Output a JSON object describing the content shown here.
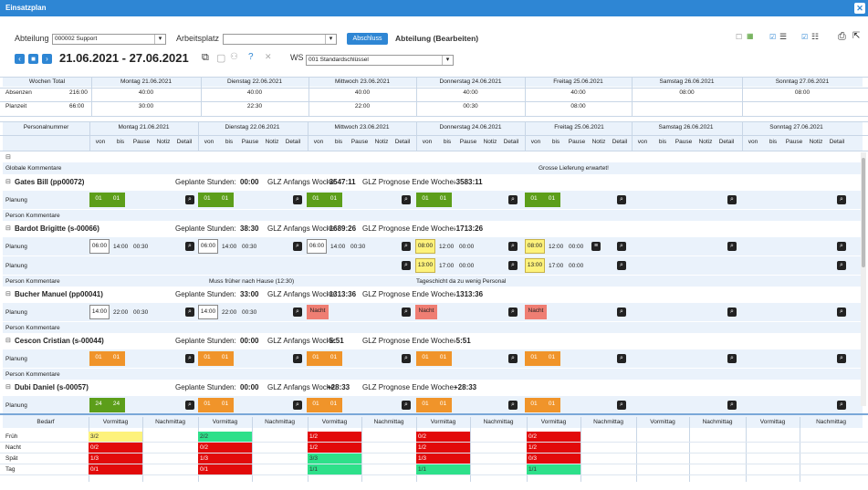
{
  "title": "Einsatzplan",
  "toolbar": {
    "abteilung_label": "Abteilung",
    "abteilung_value": "000002 Support",
    "arbeitsplatz_label": "Arbeitsplatz",
    "arbeitsplatz_value": "",
    "abschluss_label": "Abschluss",
    "abteilung_edit": "Abteilung (Bearbeiten)",
    "date_range": "21.06.2021 - 27.06.2021",
    "ws_label": "WS",
    "ws_value": "001 Standardschlüssel"
  },
  "summary": {
    "header": [
      "Wochen Total",
      "Montag 21.06.2021",
      "Dienstag 22.06.2021",
      "Mittwoch 23.06.2021",
      "Donnerstag 24.06.2021",
      "Freitag 25.06.2021",
      "Samstag 26.06.2021",
      "Sonntag 27.06.2021"
    ],
    "rows": [
      {
        "label": "Absenzen",
        "total": "216:00",
        "days": [
          "40:00",
          "40:00",
          "40:00",
          "40:00",
          "40:00",
          "08:00",
          "08:00"
        ]
      },
      {
        "label": "Planzeit",
        "total": "66:00",
        "days": [
          "30:00",
          "22:30",
          "22:00",
          "00:30",
          "08:00",
          "",
          ""
        ]
      }
    ]
  },
  "grid": {
    "personal_header": "Personalnummer",
    "days": [
      "Montag 21.06.2021",
      "Dienstag 22.06.2021",
      "Mittwoch 23.06.2021",
      "Donnerstag 24.06.2021",
      "Freitag 25.06.2021",
      "Samstag 26.06.2021",
      "Sonntag 27.06.2021"
    ],
    "sub": [
      "von",
      "bis",
      "Pause",
      "Notiz",
      "Detail"
    ],
    "global_comments": "Globale Kommentare",
    "global_note": "Grosse Lieferung erwartet!",
    "planung": "Planung",
    "person_comments": "Person Kommentare",
    "geplante": "Geplante Stunden:",
    "glz_anfang": "GLZ Anfangs Woche:",
    "glz_prognose": "GLZ Prognose Ende Woche:",
    "persons": [
      {
        "name": "Gates Bill (pp00072)",
        "hours": "00:00",
        "anfang": "-3547:11",
        "prognose": "-3583:11"
      },
      {
        "name": "Bardot Brigitte (s-00066)",
        "hours": "38:30",
        "anfang": "-1689:26",
        "prognose": "-1713:26",
        "comment_tue": "Muss früher nach Hause (12:30)",
        "comment_thu": "Tageschicht da zu wenig Personal"
      },
      {
        "name": "Bucher Manuel (pp00041)",
        "hours": "33:00",
        "anfang": "-1313:36",
        "prognose": "-1313:36"
      },
      {
        "name": "Cescon Cristian (s-00044)",
        "hours": "00:00",
        "anfang": "-5:51",
        "prognose": "-5:51"
      },
      {
        "name": "Dubi Daniel (s-00057)",
        "hours": "00:00",
        "anfang": "+28:33",
        "prognose": "+28:33"
      }
    ],
    "vals": {
      "o1": "01",
      "t0600": "06:00",
      "t1400": "14:00",
      "t0030": "00:30",
      "t0800": "08:00",
      "t1200": "12:00",
      "t0000": "00:00",
      "t1300": "13:00",
      "t1700": "17:00",
      "t2200": "22:00",
      "nacht": "Nacht",
      "t24": "24"
    }
  },
  "bedarf": {
    "header": [
      "Bedarf",
      "Vormittag",
      "Nachmittag",
      "Vormittag",
      "Nachmittag",
      "Vormittag",
      "Nachmittag",
      "Vormittag",
      "Nachmittag",
      "Vormittag",
      "Nachmittag",
      "Vormittag",
      "Nachmittag",
      "Vormittag",
      "Nachmittag"
    ],
    "rows": [
      {
        "label": "Früh",
        "vals": [
          "3/2",
          "2/2",
          "1/2",
          "0/2",
          "0/2"
        ]
      },
      {
        "label": "Nacht",
        "vals": [
          "0/2",
          "0/2",
          "1/2",
          "1/2",
          "1/2"
        ]
      },
      {
        "label": "Spät",
        "vals": [
          "1/3",
          "1/3",
          "3/3",
          "1/3",
          "0/3"
        ]
      },
      {
        "label": "Tag",
        "vals": [
          "0/1",
          "0/1",
          "1/1",
          "1/1",
          "1/1"
        ]
      }
    ]
  },
  "colors": {
    "accent": "#2e86d4",
    "green": "#5c9e1a",
    "orange": "#f0942a",
    "red": "#ef7e73",
    "yellow": "#fdf27b",
    "bedarf_red": "#e20a0a",
    "bedarf_green": "#2ee08a"
  }
}
